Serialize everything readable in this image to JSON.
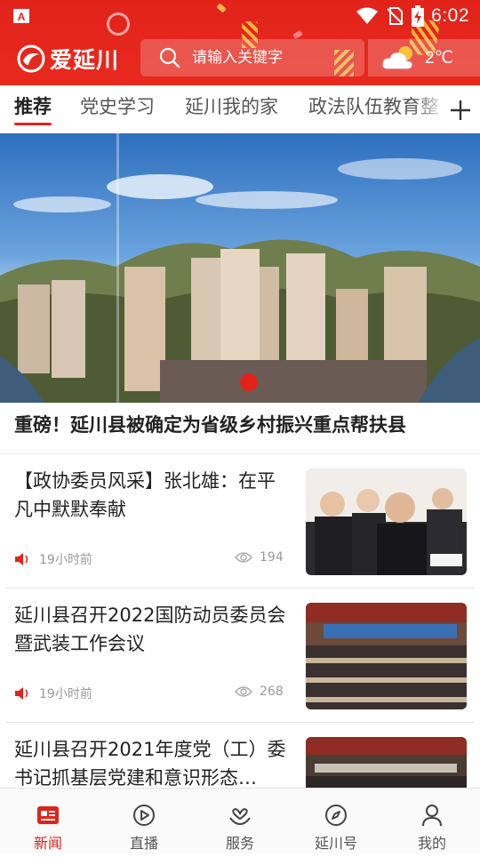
{
  "status_bar": {
    "time": "6:02"
  },
  "header": {
    "logo_text": "爱延川",
    "search": {
      "placeholder": "请输入关键字"
    },
    "weather": {
      "temperature": "2℃",
      "icon": "partly-cloudy-icon"
    },
    "colors": {
      "brand_red": "#e2231a"
    }
  },
  "tabs": {
    "items": [
      {
        "label": "推荐",
        "active": true
      },
      {
        "label": "党史学习",
        "active": false
      },
      {
        "label": "延川我的家",
        "active": false
      },
      {
        "label": "政法队伍教育整",
        "active": false
      }
    ],
    "add_icon": "plus-icon"
  },
  "banner": {
    "headline": "重磅！延川县被确定为省级乡村振兴重点帮扶县"
  },
  "news": [
    {
      "title": "【政协委员风采】张北雄：在平凡中默默奉献",
      "time": "19小时前",
      "views": "194"
    },
    {
      "title": "延川县召开2022国防动员委员会暨武装工作会议",
      "time": "19小时前",
      "views": "268"
    },
    {
      "title": "延川县召开2021年度党（工）委书记抓基层党建和意识形态…",
      "time": "",
      "views": ""
    }
  ],
  "bottom_nav": [
    {
      "label": "新闻",
      "icon": "news-icon",
      "active": true
    },
    {
      "label": "直播",
      "icon": "play-icon",
      "active": false
    },
    {
      "label": "服务",
      "icon": "service-icon",
      "active": false
    },
    {
      "label": "延川号",
      "icon": "compass-icon",
      "active": false
    },
    {
      "label": "我的",
      "icon": "user-icon",
      "active": false
    }
  ]
}
